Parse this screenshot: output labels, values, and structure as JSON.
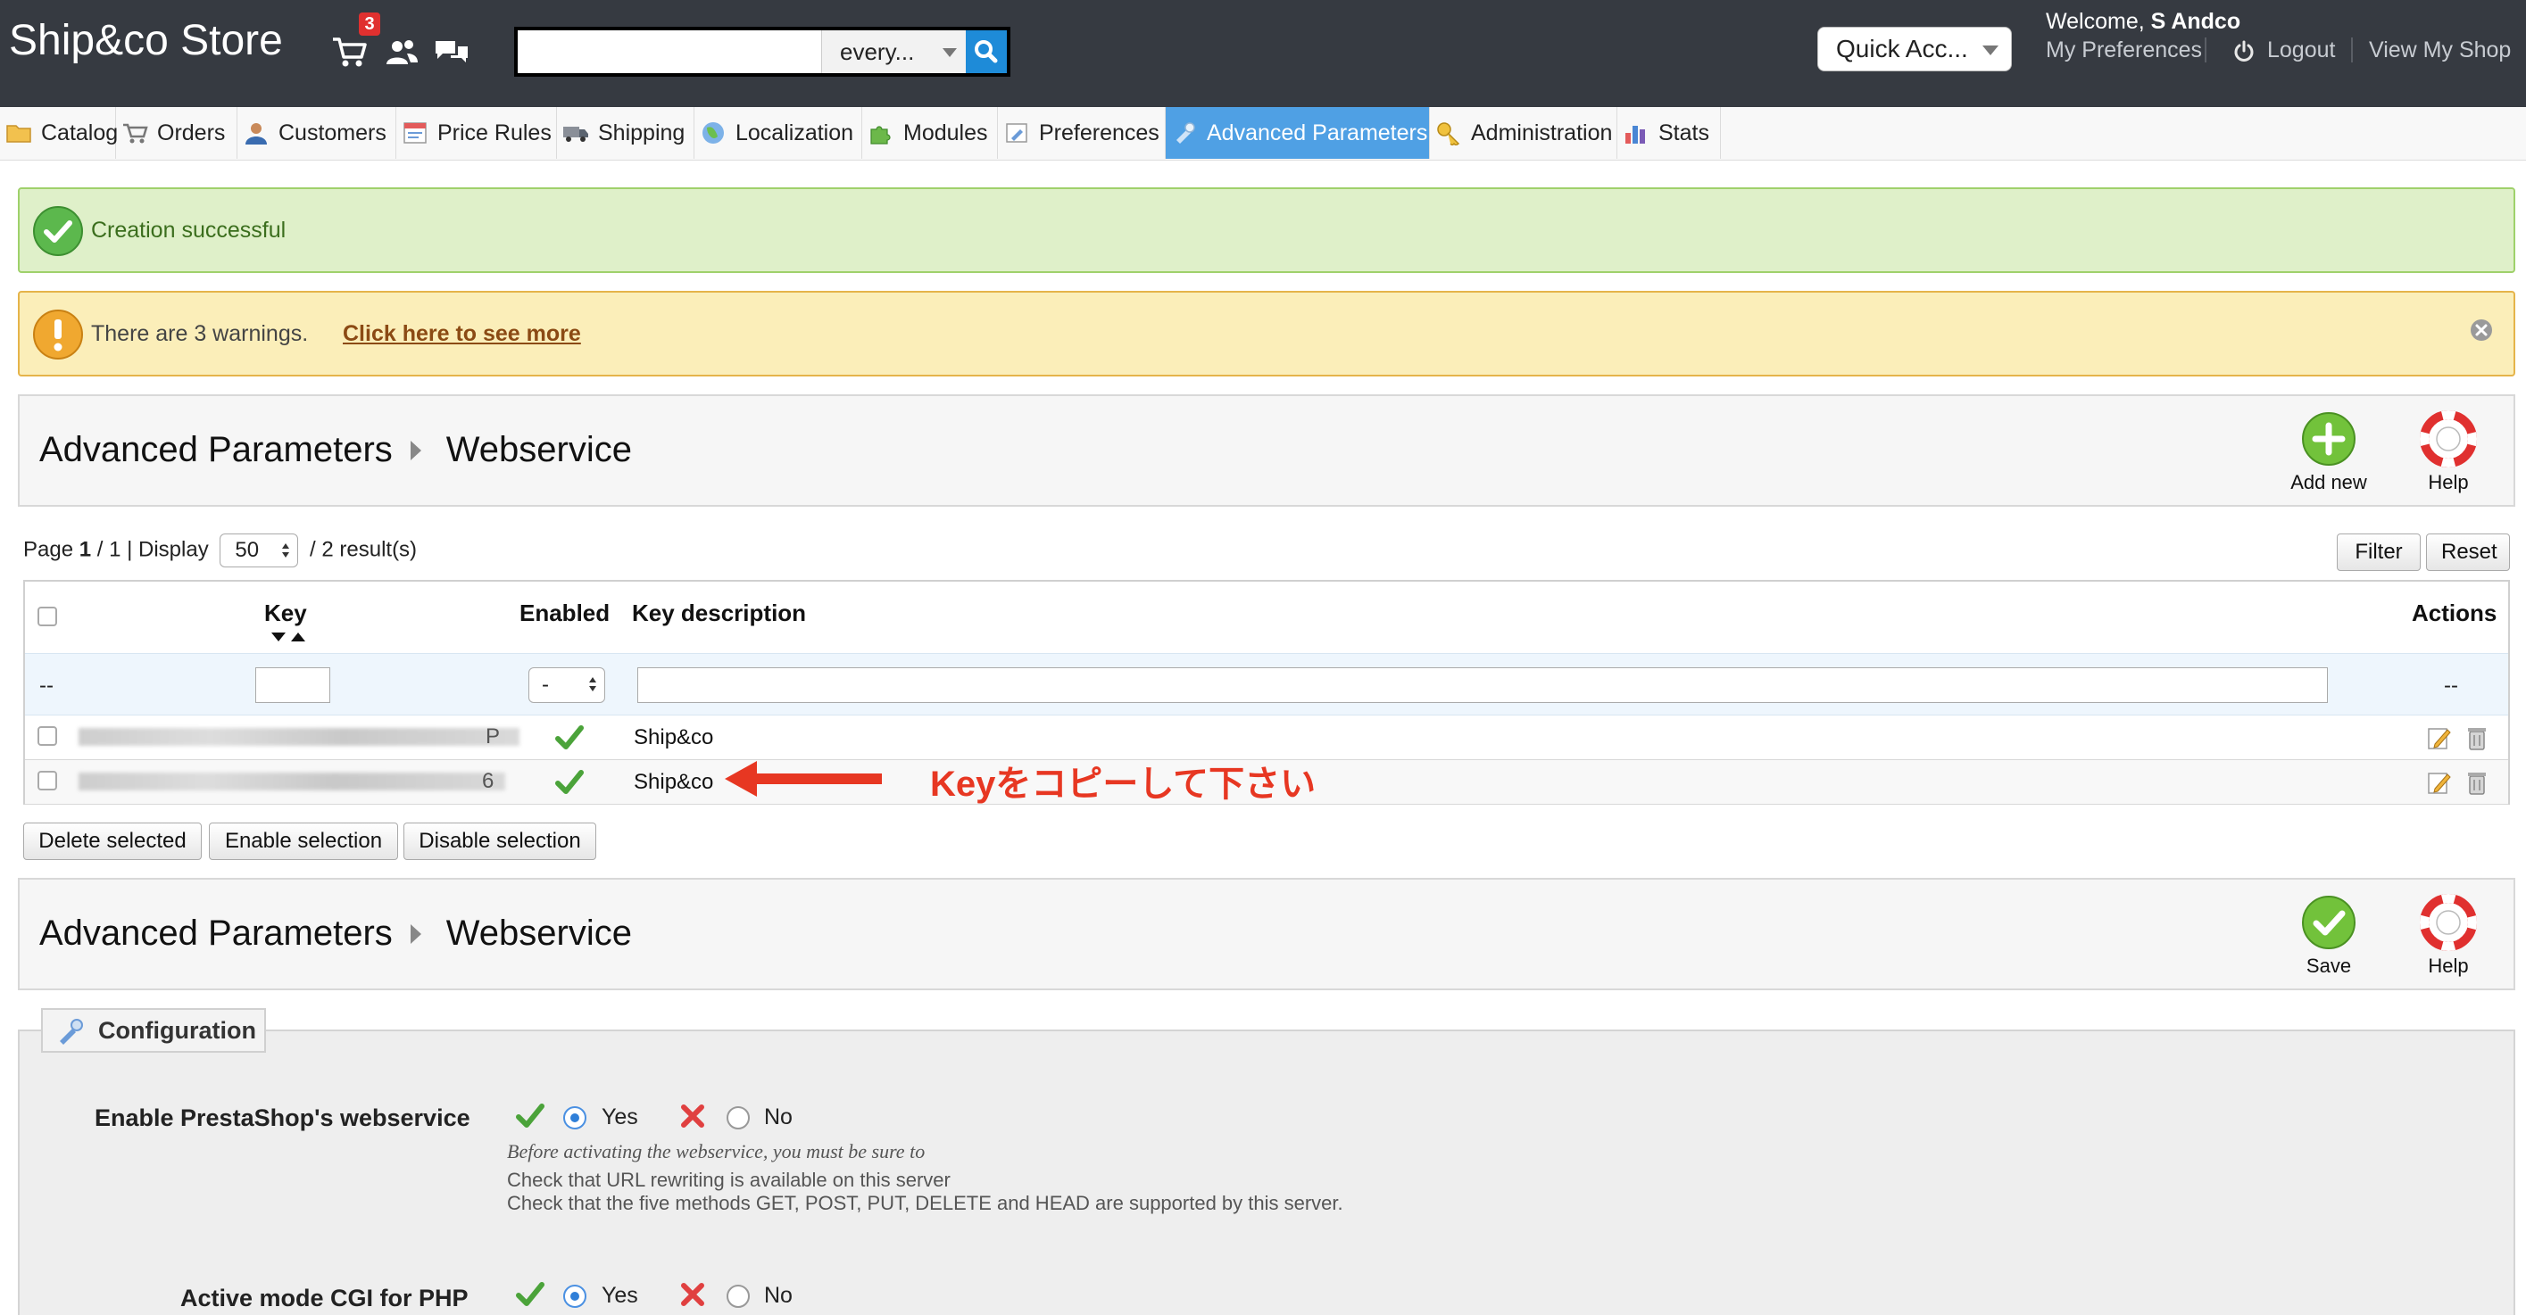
{
  "header": {
    "shop_name": "Ship&co Store",
    "cart_count": "3",
    "search": {
      "value": "",
      "placeholder": "",
      "scope": "every..."
    },
    "quick_access": "Quick Acc...",
    "welcome_prefix": "Welcome, ",
    "user_name": "S Andco",
    "links": {
      "preferences": "My Preferences",
      "logout": "Logout",
      "view_shop": "View My Shop"
    }
  },
  "menu": [
    {
      "label": "Catalog",
      "icon": "folder-icon"
    },
    {
      "label": "Orders",
      "icon": "cart-icon"
    },
    {
      "label": "Customers",
      "icon": "user-icon"
    },
    {
      "label": "Price Rules",
      "icon": "price-tag-icon"
    },
    {
      "label": "Shipping",
      "icon": "truck-icon"
    },
    {
      "label": "Localization",
      "icon": "globe-icon"
    },
    {
      "label": "Modules",
      "icon": "puzzle-icon"
    },
    {
      "label": "Preferences",
      "icon": "wrench-icon"
    },
    {
      "label": "Advanced Parameters",
      "icon": "tools-icon",
      "active": true
    },
    {
      "label": "Administration",
      "icon": "key-icon"
    },
    {
      "label": "Stats",
      "icon": "bar-chart-icon"
    }
  ],
  "alerts": {
    "success": "Creation successful",
    "warning": "There are 3 warnings.",
    "warning_link": "Click here to see more"
  },
  "toolbar": {
    "breadcrumb_parent": "Advanced Parameters",
    "breadcrumb_current": "Webservice",
    "add_new": "Add new",
    "help": "Help",
    "save": "Save"
  },
  "pagination": {
    "page_label": "Page ",
    "current_page": "1",
    "total_pages": " / 1 | Display ",
    "per_page": "50",
    "results": " / 2 result(s)",
    "filter": "Filter",
    "reset": "Reset"
  },
  "table": {
    "columns": {
      "key": "Key",
      "enabled": "Enabled",
      "description": "Key description",
      "actions": "Actions"
    },
    "filter_dash": "--",
    "enabled_filter": "-",
    "rows": [
      {
        "key_tail": "P",
        "enabled": true,
        "description": "Ship&co"
      },
      {
        "key_tail": "6",
        "enabled": true,
        "description": "Ship&co"
      }
    ]
  },
  "bulk": {
    "delete": "Delete selected",
    "enable": "Enable selection",
    "disable": "Disable selection"
  },
  "annotation": "Keyをコピーして下さい",
  "colors": {
    "header_bg": "#363a41",
    "active_menu": "#4fa0e4",
    "success_bg": "#dff0c9",
    "warning_bg": "#fbeeb9",
    "annotation": "#e73722"
  },
  "config": {
    "legend": "Configuration",
    "webservice_label": "Enable PrestaShop's webservice",
    "webservice_value": "Yes",
    "yes": "Yes",
    "no": "No",
    "note_italic": "Before activating the webservice, you must be sure to",
    "note_1": "Check that URL rewriting is available on this server",
    "note_2": "Check that the five methods GET, POST, PUT, DELETE and HEAD are supported by this server.",
    "cgi_label": "Active mode CGI for PHP",
    "cgi_value": "Yes"
  }
}
